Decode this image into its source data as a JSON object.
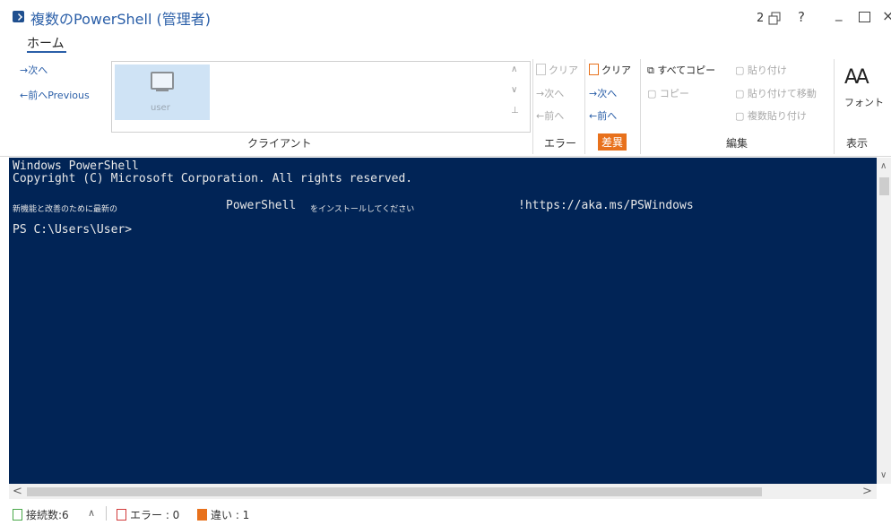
{
  "window": {
    "title": "複数のPowerShell (管理者)",
    "window_count": "2",
    "help": "?",
    "minimize": "_",
    "close": "×"
  },
  "ribbon": {
    "tab_home": "ホーム",
    "nav": {
      "next": "→次へ",
      "prev": "←前へPrevious"
    },
    "client": {
      "tile_label": "user",
      "group_label": "クライアント"
    },
    "error": {
      "clear": "クリア",
      "next": "→次へ",
      "prev": "←前へ",
      "group_label": "エラー"
    },
    "diff": {
      "clear": "クリア",
      "next": "→次へ",
      "prev": "←前へ",
      "group_label": "差異"
    },
    "edit": {
      "copy_all": "すべてコピー",
      "copy": "コピー",
      "paste": "貼り付け",
      "paste_move": "貼り付けて移動",
      "paste_multi": "複数貼り付け",
      "group_label": "編集"
    },
    "view": {
      "font_glyph": "AA",
      "font_label": "フォント",
      "group_label": "表示"
    }
  },
  "console": {
    "line1": "Windows PowerShell",
    "line2": "Copyright (C) Microsoft Corporation. All rights reserved.",
    "msg_part1": "新機能と改善のために最新の",
    "msg_part2": "PowerShell",
    "msg_part3": "をインストールしてください",
    "msg_part4": "!https://aka.ms/PSWindows",
    "prompt": "PS C:\\Users\\User>"
  },
  "statusbar": {
    "connections": "接続数:6",
    "errors": "エラー : 0",
    "diffs": "違い : 1"
  },
  "colors": {
    "console_bg": "#012456",
    "accent_blue": "#2b5fa8",
    "diff_orange": "#e8711c",
    "client_tile": "#cfe3f5"
  }
}
